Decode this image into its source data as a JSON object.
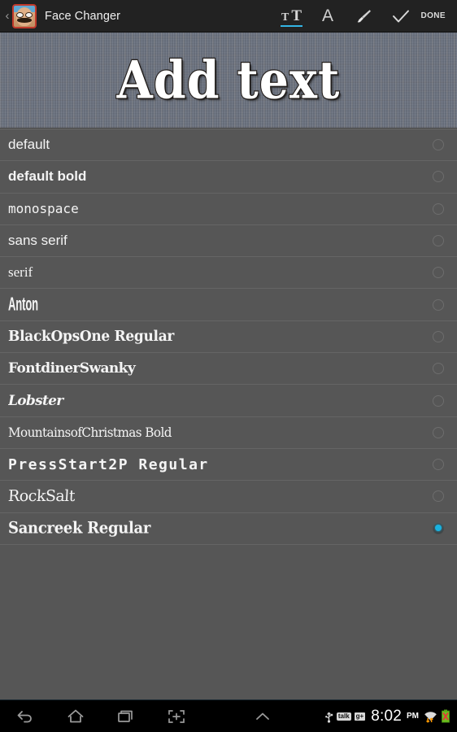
{
  "titlebar": {
    "back_caret": "‹",
    "app_icon_name": "face-changer-app-icon",
    "title": "Face Changer",
    "tools": [
      {
        "name": "text-size-tool",
        "type": "tt",
        "label_small": "T",
        "label_big": "T",
        "active": true
      },
      {
        "name": "font-tool",
        "type": "a",
        "label": "A",
        "active": false
      },
      {
        "name": "brush-tool",
        "type": "brush",
        "label": "",
        "active": false
      },
      {
        "name": "apply-check-tool",
        "type": "check",
        "label": "",
        "active": false
      }
    ],
    "done_label": "DONE",
    "accent_color": "#33b5e5"
  },
  "preview": {
    "text": "Add text",
    "text_color": "#ffffff",
    "outline_color": "#241f1c",
    "background_color": "#6c7381"
  },
  "font_list": {
    "selected_index": 12,
    "selected_color": "#19b2e0",
    "rows": [
      {
        "label": "default",
        "style": "f-default",
        "selected": false
      },
      {
        "label": "default bold",
        "style": "f-default-bold",
        "selected": false
      },
      {
        "label": "monospace",
        "style": "f-monospace",
        "selected": false
      },
      {
        "label": "sans serif",
        "style": "f-sans",
        "selected": false
      },
      {
        "label": "serif",
        "style": "f-serif",
        "selected": false
      },
      {
        "label": "Anton",
        "style": "f-anton",
        "selected": false
      },
      {
        "label": "BlackOpsOne Regular",
        "style": "f-blackops",
        "selected": false
      },
      {
        "label": "FontdinerSwanky",
        "style": "f-fontdiner",
        "selected": false
      },
      {
        "label": "Lobster",
        "style": "f-lobster",
        "selected": false
      },
      {
        "label": "MountainsofChristmas Bold",
        "style": "f-mountains",
        "selected": false
      },
      {
        "label": "PressStart2P Regular",
        "style": "f-pressstart",
        "selected": false
      },
      {
        "label": "RockSalt",
        "style": "f-rocksalt",
        "selected": false
      },
      {
        "label": "Sancreek Regular",
        "style": "f-sancreek",
        "selected": true
      }
    ]
  },
  "navbar": {
    "buttons": [
      {
        "name": "back-button",
        "icon": "back-arrow-icon"
      },
      {
        "name": "home-button",
        "icon": "home-icon"
      },
      {
        "name": "recents-button",
        "icon": "recent-apps-icon"
      },
      {
        "name": "screenshot-button",
        "icon": "screenshot-icon"
      },
      {
        "name": "expand-button",
        "icon": "chevron-up-icon"
      }
    ],
    "status": {
      "usb": "usb-icon",
      "talk_badge": "talk",
      "gplus_badge": "g+",
      "time": "8:02",
      "ampm": "PM",
      "wifi": "wifi-icon",
      "battery": "battery-error-icon"
    }
  }
}
